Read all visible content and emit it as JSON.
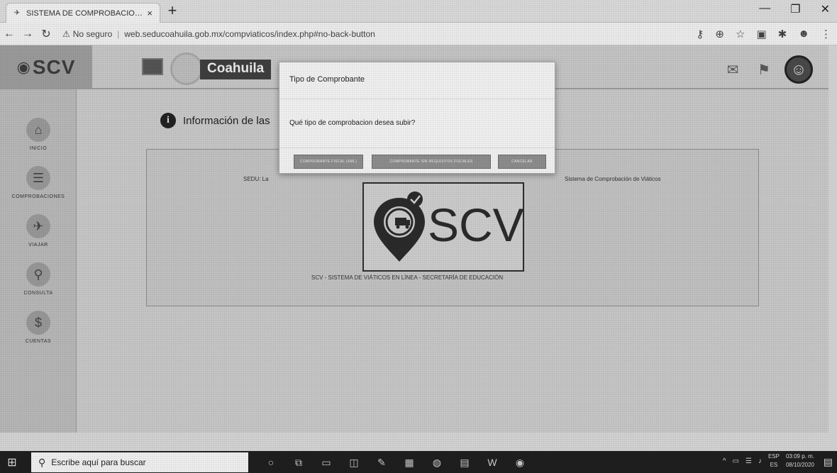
{
  "browser": {
    "tab_title": "SISTEMA DE COMPROBACION E",
    "tab_close": "×",
    "new_tab": "+",
    "window_controls": [
      "—",
      "❐",
      "✕"
    ],
    "security_label": "No seguro",
    "url": "web.seducoahuila.gob.mx/compviaticos/index.php#no-back-button"
  },
  "header": {
    "brand": "SCV",
    "state_name": "Coahuila"
  },
  "sidebar": {
    "items": [
      {
        "label": "INICIO",
        "icon": "home-icon"
      },
      {
        "label": "COMPROBACIONES",
        "icon": "receipt-icon"
      },
      {
        "label": "VIAJAR",
        "icon": "travel-icon"
      },
      {
        "label": "CONSULTA",
        "icon": "search-icon"
      },
      {
        "label": "CUENTAS",
        "icon": "accounts-icon"
      }
    ]
  },
  "main": {
    "info_title": "Información de las",
    "welcome_text": "SEDU: La",
    "welcome_text_tail": "Sistema de Comprobación de Viáticos",
    "logo_text": "SCV",
    "panel_footer": "SCV - SISTEMA DE VIÁTICOS EN LÍNEA - SECRETARÍA DE EDUCACIÓN"
  },
  "modal": {
    "title": "Tipo de Comprobante",
    "question": "Qué tipo de comprobacion desea subir?",
    "buttons": [
      "COMPROBANTE FISCAL (XML)",
      "COMPROBANTE SIN REQUISITOS FISCALES",
      "CANCELAR"
    ]
  },
  "taskbar": {
    "search_placeholder": "Escribe aquí para buscar",
    "language_top": "ESP",
    "language_bottom": "ES",
    "time": "03:09 p. m.",
    "date": "08/10/2020"
  }
}
